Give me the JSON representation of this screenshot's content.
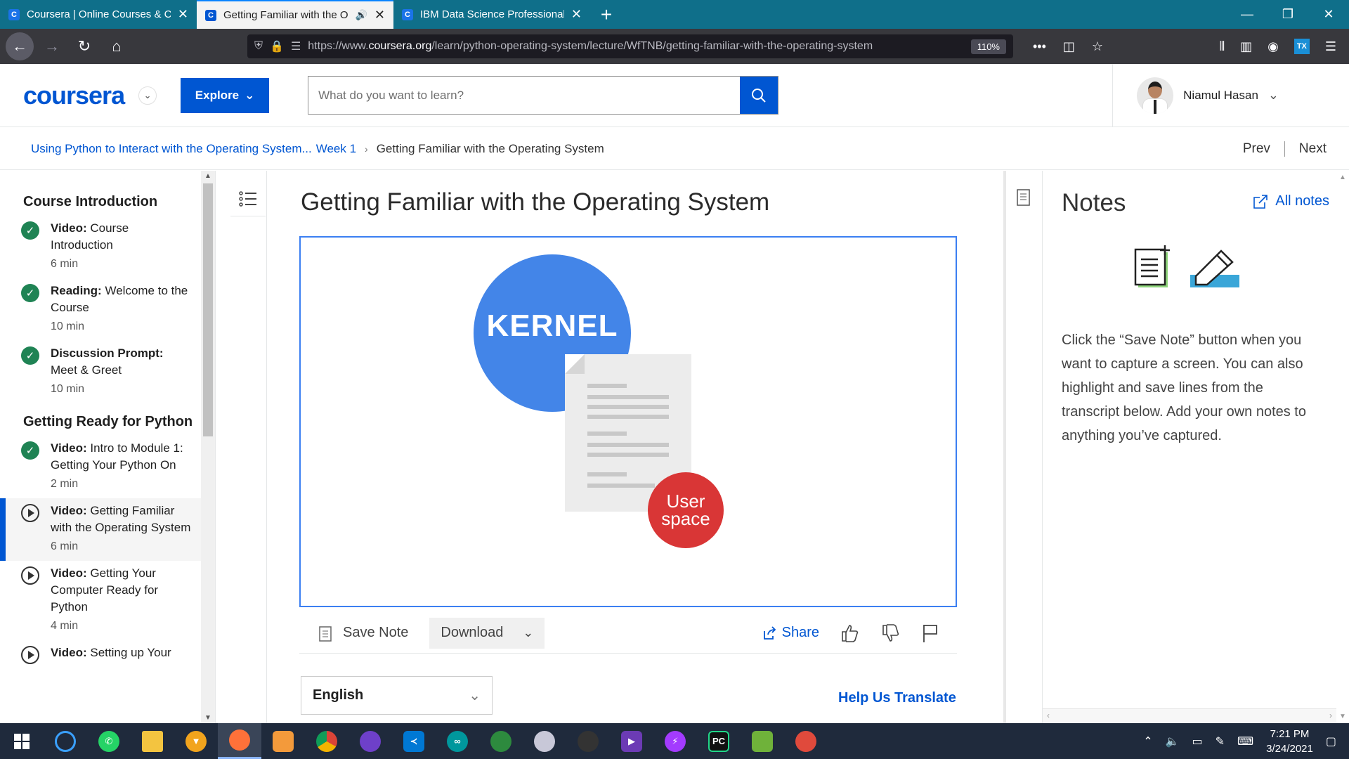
{
  "browser": {
    "tabs": [
      {
        "title": "Coursera | Online Courses & Cr",
        "favicon": "C",
        "active": false
      },
      {
        "title": "Getting Familiar with the Op",
        "favicon": "C",
        "active": true
      },
      {
        "title": "IBM Data Science Professional",
        "favicon": "C",
        "active": false
      }
    ],
    "url_prefix": "https://www.",
    "url_domain": "coursera.org",
    "url_path": "/learn/python-operating-system/lecture/WfTNB/getting-familiar-with-the-operating-system",
    "zoom": "110%"
  },
  "header": {
    "logo": "coursera",
    "explore_label": "Explore",
    "search_placeholder": "What do you want to learn?",
    "user_name": "Niamul Hasan"
  },
  "breadcrumb": {
    "course": "Using Python to Interact with the Operating System...",
    "week": "Week 1",
    "current": "Getting Familiar with the Operating System",
    "prev": "Prev",
    "next": "Next"
  },
  "sidebar": {
    "sections": [
      {
        "title": "Course Introduction",
        "items": [
          {
            "type": "Video:",
            "name": "Course Introduction",
            "duration": "6 min",
            "status": "done"
          },
          {
            "type": "Reading:",
            "name": "Welcome to the Course",
            "duration": "10 min",
            "status": "done"
          },
          {
            "type": "Discussion Prompt:",
            "name": "Meet & Greet",
            "duration": "10 min",
            "status": "done"
          }
        ]
      },
      {
        "title": "Getting Ready for Python",
        "items": [
          {
            "type": "Video:",
            "name": "Intro to Module 1: Getting Your Python On",
            "duration": "2 min",
            "status": "done"
          },
          {
            "type": "Video:",
            "name": "Getting Familiar with the Operating System",
            "duration": "6 min",
            "status": "current"
          },
          {
            "type": "Video:",
            "name": "Getting Your Computer Ready for Python",
            "duration": "4 min",
            "status": "todo"
          },
          {
            "type": "Video:",
            "name": "Setting up Your",
            "duration": "",
            "status": "todo"
          }
        ]
      }
    ]
  },
  "main": {
    "title": "Getting Familiar with the Operating System",
    "video": {
      "kernel_label": "KERNEL",
      "userspace_label": "User space"
    },
    "actions": {
      "save_note": "Save Note",
      "download": "Download",
      "share": "Share"
    },
    "language": "English",
    "help_translate": "Help Us Translate"
  },
  "notes": {
    "title": "Notes",
    "all_notes": "All notes",
    "description": "Click the “Save Note” button when you want to capture a screen. You can also highlight and save lines from the transcript below. Add your own notes to anything you’ve captured."
  },
  "taskbar": {
    "time": "7:21 PM",
    "date": "3/24/2021"
  },
  "colors": {
    "brand": "#0056d2",
    "done_check": "#1f8354",
    "kernel_blue": "#4385e8",
    "userspace_red": "#d93636"
  }
}
